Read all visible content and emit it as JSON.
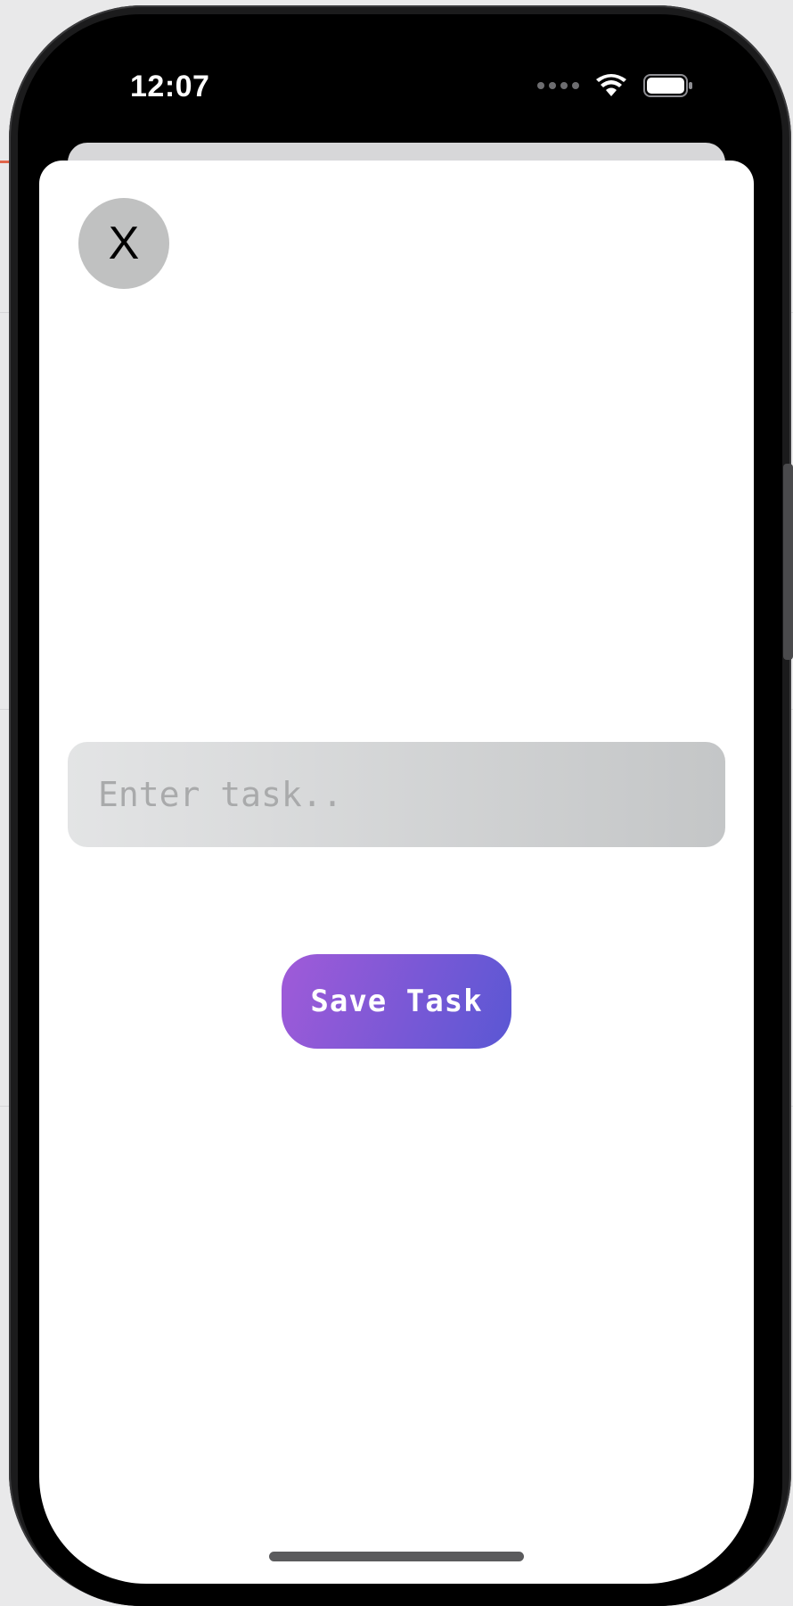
{
  "status_bar": {
    "time": "12:07"
  },
  "modal": {
    "close_label": "X",
    "task_input": {
      "value": "",
      "placeholder": "Enter task.."
    },
    "save_label": "Save Task"
  },
  "colors": {
    "save_gradient_start": "#a05ad8",
    "save_gradient_end": "#5a57d4",
    "close_bg": "#c0c1c1",
    "input_gradient_start": "#e3e4e5",
    "input_gradient_end": "#c4c6c7"
  },
  "icons": [
    "signal-icon",
    "wifi-icon",
    "battery-icon"
  ]
}
